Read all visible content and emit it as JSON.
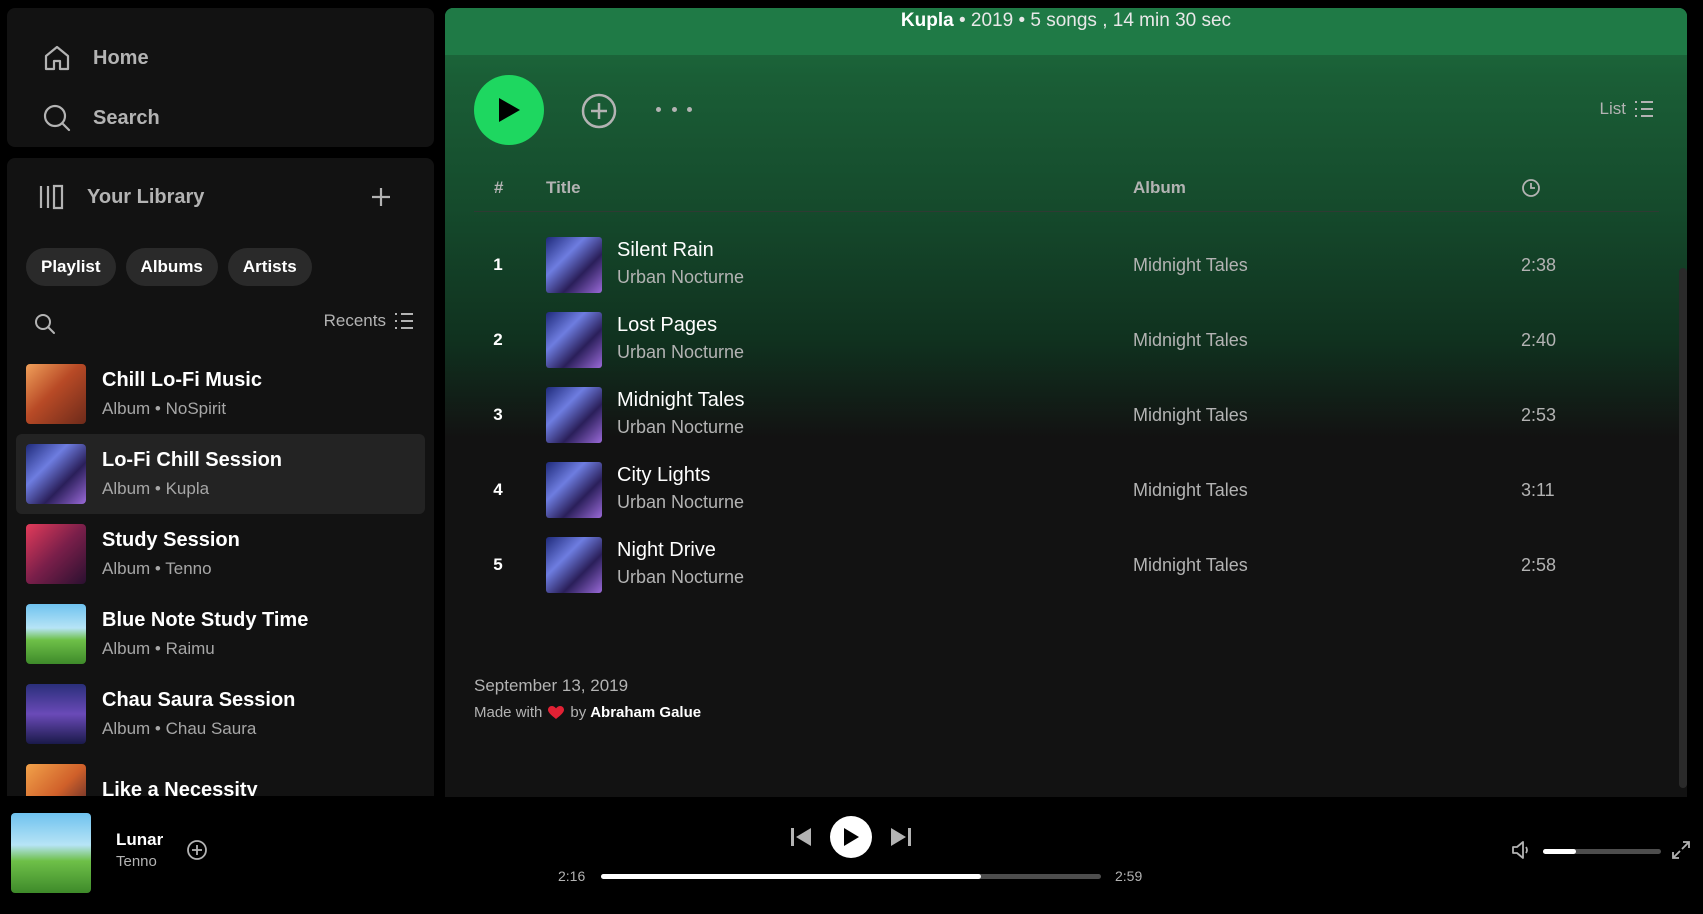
{
  "nav": {
    "home_label": "Home",
    "search_label": "Search"
  },
  "library": {
    "title": "Your Library",
    "filters": [
      "Playlist",
      "Albums",
      "Artists"
    ],
    "sort_label": "Recents",
    "items": [
      {
        "name": "Chill Lo-Fi Music",
        "meta": "Album • NoSpirit",
        "cover": "cov-chill"
      },
      {
        "name": "Lo-Fi Chill Session",
        "meta": "Album • Kupla",
        "cover": "cov-lofi",
        "active": true
      },
      {
        "name": "Study Session",
        "meta": "Album • Tenno",
        "cover": "cov-study"
      },
      {
        "name": "Blue Note Study Time",
        "meta": "Album • Raimu",
        "cover": "cov-blue"
      },
      {
        "name": "Chau Saura Session",
        "meta": "Album • Chau Saura",
        "cover": "cov-chau"
      },
      {
        "name": "Like a Necessity",
        "meta": "",
        "cover": "cov-like"
      }
    ]
  },
  "album": {
    "artist": "Kupla",
    "summary": " • 2019 • 5 songs , 14 min 30 sec",
    "view_label": "List",
    "columns": {
      "num": "#",
      "title": "Title",
      "album": "Album"
    },
    "tracks": [
      {
        "num": "1",
        "name": "Silent Rain",
        "artist": "Urban Nocturne",
        "album": "Midnight Tales",
        "duration": "2:38"
      },
      {
        "num": "2",
        "name": "Lost Pages",
        "artist": "Urban Nocturne",
        "album": "Midnight Tales",
        "duration": "2:40"
      },
      {
        "num": "3",
        "name": "Midnight Tales",
        "artist": "Urban Nocturne",
        "album": "Midnight Tales",
        "duration": "2:53"
      },
      {
        "num": "4",
        "name": "City Lights",
        "artist": "Urban Nocturne",
        "album": "Midnight Tales",
        "duration": "3:11"
      },
      {
        "num": "5",
        "name": "Night Drive",
        "artist": "Urban Nocturne",
        "album": "Midnight Tales",
        "duration": "2:58"
      }
    ],
    "release_date": "September 13, 2019",
    "credit_prefix": "Made with",
    "credit_by": "by",
    "credit_author": "Abraham Galue"
  },
  "player": {
    "title": "Lunar",
    "artist": "Tenno",
    "time_current": "2:16",
    "time_total": "2:59",
    "progress_fraction": 0.76,
    "volume_fraction": 0.28
  },
  "colors": {
    "accent": "#1ed760",
    "header_green": "#1f7a46",
    "heart": "#e22134"
  }
}
